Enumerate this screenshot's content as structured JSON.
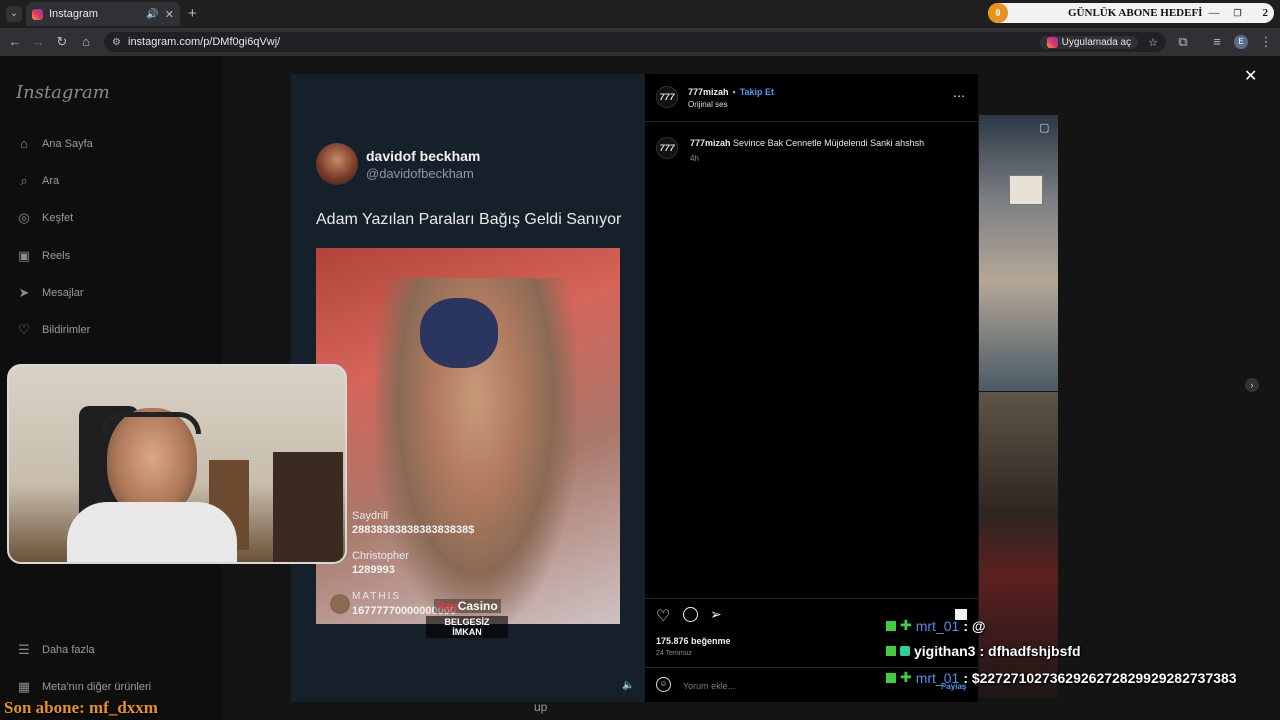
{
  "browser": {
    "tab_title": "Instagram",
    "url": "instagram.com/p/DMf0gi6qVwj/",
    "open_in_app": "Uygulamada aç",
    "profile_initial": "E"
  },
  "overlay_top": {
    "count": "0",
    "label": "GÜNLÜK ABONE HEDEFİ",
    "target": "2"
  },
  "sidebar": {
    "logo": "Instagram",
    "items": [
      {
        "label": "Ana Sayfa",
        "icon": "home-icon"
      },
      {
        "label": "Ara",
        "icon": "search-icon"
      },
      {
        "label": "Keşfet",
        "icon": "compass-icon"
      },
      {
        "label": "Reels",
        "icon": "reels-icon"
      },
      {
        "label": "Mesajlar",
        "icon": "send-icon"
      },
      {
        "label": "Bildirimler",
        "icon": "heart-icon"
      }
    ],
    "more": "Daha fazla",
    "meta": "Meta'nın diğer ürünleri"
  },
  "tweet": {
    "name": "davidof beckham",
    "handle": "@davidofbeckham",
    "text": "Adam Yazılan Paraları Bağış Geldi Sanıyor"
  },
  "video_overlay": {
    "donor1_name": "Saydrill",
    "donor1_amount": "2883838383838383838$",
    "donor2_name": "Christopher",
    "donor2_amount": "1289993",
    "donor3_name": "MATHIS",
    "donor3_amount": "16777770000000000",
    "brand_a": "Vay",
    "brand_b": "Casino",
    "caption_line1": "BELGESİZ",
    "caption_line2": "İMKAN"
  },
  "post": {
    "username": "777mizah",
    "follow": "Takip Et",
    "audio": "Orijinal ses",
    "caption_user": "777mizah",
    "caption_text": "Sevince Bak Cennetle Müjdelendi Sanki ahshsh",
    "caption_time": "4h",
    "likes": "175.876 beğenme",
    "date": "24 Temmuz",
    "comment_placeholder": "Yorum ekle...",
    "share": "Paylaş",
    "avatar_text": "777"
  },
  "chat": [
    {
      "user": "mrt_01",
      "msg": ": @"
    },
    {
      "user": "yigithan3",
      "msg": ": dfhadfshjbsfd"
    },
    {
      "user": "mrt_01",
      "msg": ": $227271027362926272829929282737383"
    }
  ],
  "bottom_overlay": {
    "last_sub": "Son abone: mf_dxxm",
    "center_text": "up"
  },
  "colors": {
    "follow_blue": "#4a9df8",
    "chat_user_blue": "#4f8fe8",
    "last_sub_orange": "#e8921e"
  }
}
